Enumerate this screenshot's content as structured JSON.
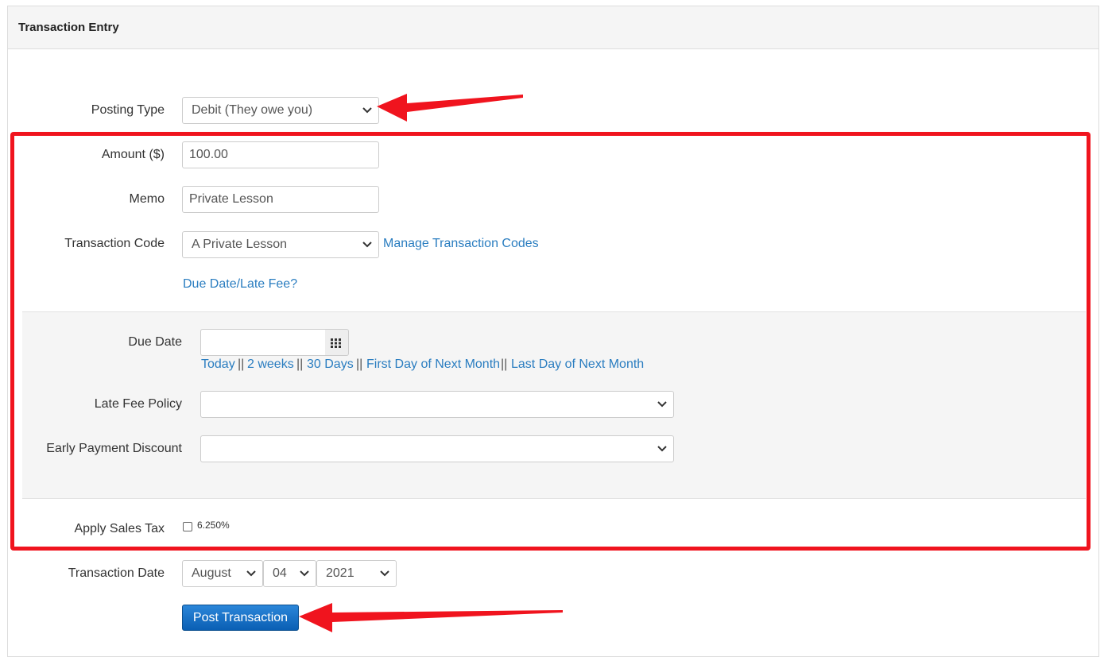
{
  "panel": {
    "title": "Transaction Entry"
  },
  "form": {
    "posting_type": {
      "label": "Posting Type",
      "value": "Debit (They owe you)"
    },
    "amount": {
      "label": "Amount ($)",
      "value": "100.00"
    },
    "memo": {
      "label": "Memo",
      "value": "Private Lesson"
    },
    "transaction_code": {
      "label": "Transaction Code",
      "value": "A Private Lesson",
      "manage_link": "Manage Transaction Codes"
    },
    "due_date_toggle": "Due Date/Late Fee?",
    "due_date": {
      "label": "Due Date",
      "value": "",
      "shortcuts": [
        "Today",
        "2 weeks",
        "30 Days",
        "First Day of Next Month",
        "Last Day of Next Month"
      ],
      "separator": "||"
    },
    "late_fee_policy": {
      "label": "Late Fee Policy",
      "value": ""
    },
    "early_payment_discount": {
      "label": "Early Payment Discount",
      "value": ""
    },
    "sales_tax": {
      "label": "Apply Sales Tax",
      "rate": "6.250%",
      "checked": false
    },
    "transaction_date": {
      "label": "Transaction Date",
      "month": "August",
      "day": "04",
      "year": "2021"
    },
    "submit_label": "Post Transaction"
  },
  "annotations": {
    "color": "#f0141e"
  },
  "colors": {
    "link": "#2a7dc0",
    "primary_button": "#0a5fb4"
  }
}
